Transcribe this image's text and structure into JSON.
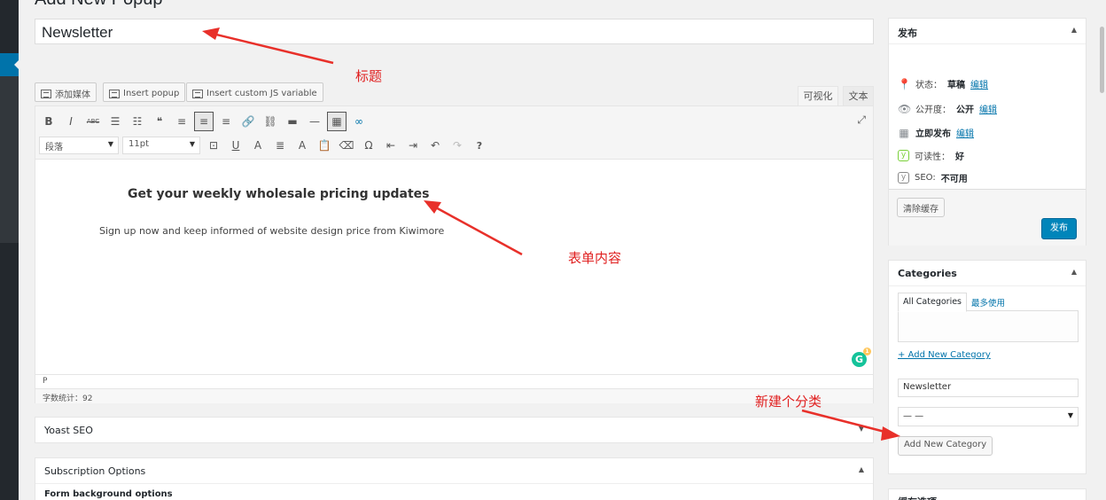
{
  "page": {
    "title": "Add New Popup"
  },
  "post_title": {
    "value": "Newsletter"
  },
  "media_buttons": [
    {
      "label": "添加媒体",
      "icon": "media-icon"
    },
    {
      "label": "Insert popup",
      "icon": "popup-icon"
    },
    {
      "label": "Insert custom JS variable",
      "icon": "variable-icon"
    }
  ],
  "editor_tabs": {
    "visual": "可视化",
    "text": "文本"
  },
  "toolbar": {
    "row1": [
      {
        "name": "bold-icon",
        "glyph": "B"
      },
      {
        "name": "italic-icon",
        "glyph": "I"
      },
      {
        "name": "strikethrough-icon",
        "glyph": "ABC"
      },
      {
        "name": "bullet-list-icon",
        "glyph": "☰"
      },
      {
        "name": "numbered-list-icon",
        "glyph": "☷"
      },
      {
        "name": "blockquote-icon",
        "glyph": "❝"
      },
      {
        "name": "align-left-icon",
        "glyph": "≡"
      },
      {
        "name": "align-center-icon",
        "glyph": "≡"
      },
      {
        "name": "align-right-icon",
        "glyph": "≡"
      },
      {
        "name": "link-icon",
        "glyph": "🔗"
      },
      {
        "name": "unlink-icon",
        "glyph": "⛓"
      },
      {
        "name": "read-more-icon",
        "glyph": "▬"
      },
      {
        "name": "horizontal-line-icon",
        "glyph": "—"
      },
      {
        "name": "toolbar-toggle-icon",
        "glyph": "▦"
      },
      {
        "name": "insert-link-icon",
        "glyph": "∞"
      }
    ],
    "format_select": "段落",
    "size_select": "11pt",
    "row2": [
      {
        "name": "media-embed-icon",
        "glyph": "⊡"
      },
      {
        "name": "underline-icon",
        "glyph": "U"
      },
      {
        "name": "background-color-icon",
        "glyph": "A"
      },
      {
        "name": "justify-icon",
        "glyph": "≣"
      },
      {
        "name": "text-color-icon",
        "glyph": "A"
      },
      {
        "name": "paste-text-icon",
        "glyph": "📋"
      },
      {
        "name": "clear-formatting-icon",
        "glyph": "⌫"
      },
      {
        "name": "special-character-icon",
        "glyph": "Ω"
      },
      {
        "name": "outdent-icon",
        "glyph": "⇤"
      },
      {
        "name": "indent-icon",
        "glyph": "⇥"
      },
      {
        "name": "undo-icon",
        "glyph": "↶"
      },
      {
        "name": "redo-icon",
        "glyph": "↷"
      },
      {
        "name": "help-icon",
        "glyph": "?"
      }
    ],
    "fullscreen_icon": "fullscreen-icon"
  },
  "editor_content": {
    "heading": "Get your weekly wholesale pricing updates",
    "paragraph": "Sign up now and keep informed of website design price from Kiwimore"
  },
  "editor_footer": {
    "path": "P",
    "word_count": "字数统计：92"
  },
  "metaboxes": {
    "yoast": "Yoast SEO",
    "subscription": "Subscription Options",
    "subscription_sub": "Form background options"
  },
  "publish": {
    "title": "发布",
    "status_label": "状态：",
    "status_value": "草稿",
    "visibility_label": "公开度：",
    "visibility_value": "公开",
    "schedule_label": "立即发布",
    "edit_link": "编辑",
    "readability_label": "可读性：",
    "readability_value": "好",
    "seo_label": "SEO:",
    "seo_value": "不可用",
    "clear_cache": "清除缓存",
    "publish_button": "发布"
  },
  "categories": {
    "title": "Categories",
    "tab_all": "All Categories",
    "tab_most": "最多使用",
    "add_new_link": "+ Add New Category",
    "new_name_value": "Newsletter",
    "parent_select": "— —",
    "add_button": "Add New Category"
  },
  "sidebox3": {
    "title": "缓存选项"
  },
  "annotations": {
    "title": "标题",
    "content": "表单内容",
    "new_category": "新建个分类"
  },
  "colors": {
    "accent": "#0073aa",
    "primary_button": "#0085ba",
    "annotation": "#e02020",
    "admin_bar": "#23282d"
  }
}
